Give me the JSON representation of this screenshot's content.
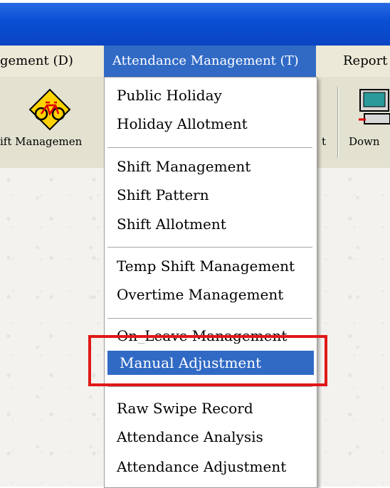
{
  "menubar": {
    "items": [
      "gement (D)",
      "Attendance Management (T)",
      "Report"
    ]
  },
  "toolbar": {
    "items": [
      {
        "label": "ift Managemen",
        "icon": "bicycle-icon"
      },
      {
        "label": "t",
        "icon": ""
      },
      {
        "label": "Down",
        "icon": "computer-download-icon"
      }
    ]
  },
  "dropdown": {
    "groups": [
      [
        "Public Holiday",
        "Holiday Allotment"
      ],
      [
        "Shift Management",
        "Shift Pattern",
        "Shift Allotment"
      ],
      [
        "Temp Shift Management",
        "Overtime Management"
      ],
      [
        "On_Leave Management",
        "Manual Adjustment"
      ],
      [
        "Raw Swipe Record",
        "Attendance Analysis",
        "Attendance Adjustment"
      ]
    ],
    "selected": "Manual Adjustment"
  },
  "colors": {
    "title_bar": "#0a4fd4",
    "menu_highlight": "#316ac5",
    "annotation": "#e01818"
  }
}
